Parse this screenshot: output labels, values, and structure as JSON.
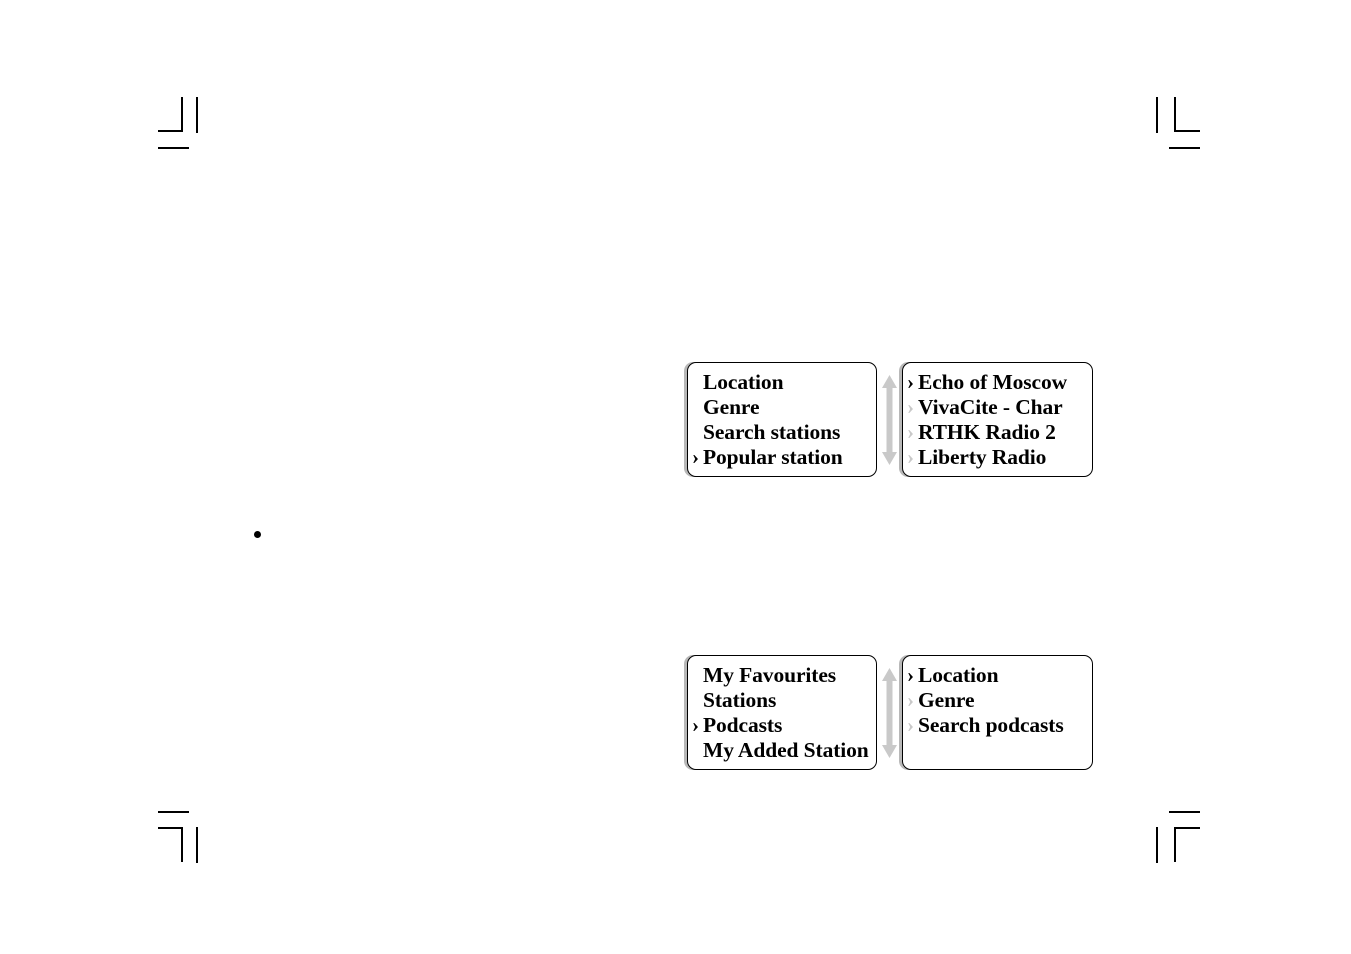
{
  "page": {
    "type": "manual-page",
    "background_color": "#ffffff",
    "mark_color": "#000000"
  },
  "crop_marks": [
    {
      "position": "top-left",
      "name": "crop-mark-top-left"
    },
    {
      "position": "top-right",
      "name": "crop-mark-top-right"
    },
    {
      "position": "bottom-left",
      "name": "crop-mark-bottom-left"
    },
    {
      "position": "bottom-right",
      "name": "crop-mark-bottom-right"
    }
  ],
  "body_bullet": {
    "name": "body-bullet",
    "color": "#000000"
  },
  "colors": {
    "text": "#000000",
    "chevron_active": "#000000",
    "chevron_inactive": "#c9c9c9",
    "screen_border": "#000000",
    "screen_shadow": "#b8b8b8",
    "scroll_arrow": "#c9c9c9"
  },
  "screen_groups": [
    {
      "id": "group-top",
      "name": "screen-group-stations",
      "left_screen": {
        "name": "lcd-screen-stations-menu",
        "items": [
          {
            "label": "Location",
            "chevron": "none",
            "selected": false
          },
          {
            "label": "Genre",
            "chevron": "none",
            "selected": false
          },
          {
            "label": "Search stations",
            "chevron": "none",
            "selected": false
          },
          {
            "label": "Popular station",
            "chevron": "active",
            "selected": true
          }
        ]
      },
      "scroll_indicator": {
        "name": "scroll-updown-arrow",
        "icon": "up-down-arrow-icon",
        "color": "#c9c9c9"
      },
      "right_screen": {
        "name": "lcd-screen-popular-stations-list",
        "items": [
          {
            "label": "Echo of Moscow",
            "chevron": "active",
            "selected": true
          },
          {
            "label": "VivaCite - Char",
            "chevron": "inactive",
            "selected": false
          },
          {
            "label": "RTHK Radio 2",
            "chevron": "inactive",
            "selected": false
          },
          {
            "label": "Liberty Radio",
            "chevron": "inactive",
            "selected": false
          }
        ]
      }
    },
    {
      "id": "group-bottom",
      "name": "screen-group-podcasts",
      "left_screen": {
        "name": "lcd-screen-main-menu",
        "items": [
          {
            "label": "My Favourites",
            "chevron": "none",
            "selected": false
          },
          {
            "label": "Stations",
            "chevron": "none",
            "selected": false
          },
          {
            "label": "Podcasts",
            "chevron": "active",
            "selected": true
          },
          {
            "label": "My Added Station",
            "chevron": "none",
            "selected": false
          }
        ]
      },
      "scroll_indicator": {
        "name": "scroll-updown-arrow",
        "icon": "up-down-arrow-icon",
        "color": "#c9c9c9"
      },
      "right_screen": {
        "name": "lcd-screen-podcasts-menu",
        "items": [
          {
            "label": "Location",
            "chevron": "active",
            "selected": true
          },
          {
            "label": "Genre",
            "chevron": "inactive",
            "selected": false
          },
          {
            "label": "Search podcasts",
            "chevron": "inactive",
            "selected": false
          }
        ]
      }
    }
  ],
  "glyphs": {
    "chevron": "›"
  }
}
